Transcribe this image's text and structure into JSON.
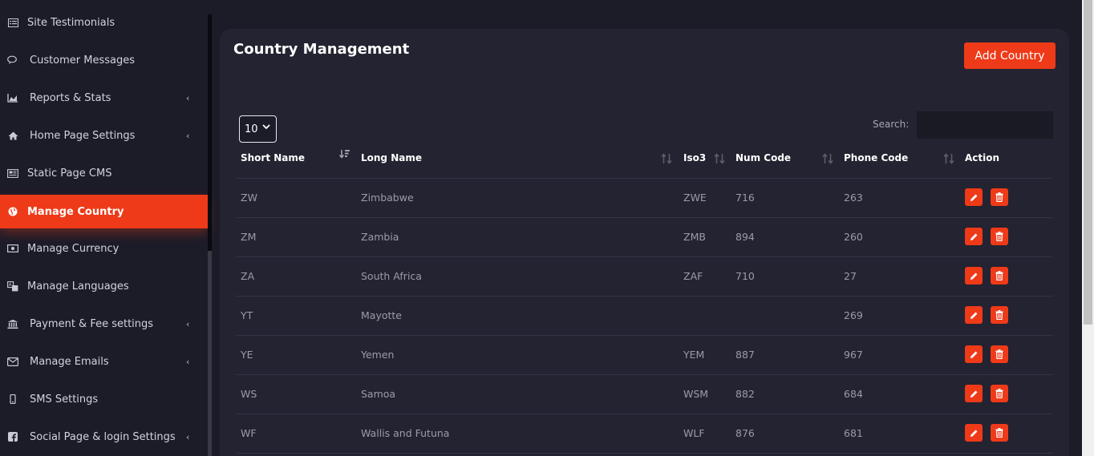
{
  "sidebar": {
    "items": [
      {
        "label": "Site Testimonials",
        "icon": "list-alt-icon",
        "chevron": false,
        "active": false
      },
      {
        "label": "Customer Messages",
        "icon": "comments-icon",
        "chevron": false,
        "active": false
      },
      {
        "label": "Reports & Stats",
        "icon": "area-chart-icon",
        "chevron": true,
        "active": false
      },
      {
        "label": "Home Page Settings",
        "icon": "home-icon",
        "chevron": true,
        "active": false
      },
      {
        "label": "Static Page CMS",
        "icon": "newspaper-icon",
        "chevron": false,
        "active": false
      },
      {
        "label": "Manage Country",
        "icon": "globe-icon",
        "chevron": false,
        "active": true
      },
      {
        "label": "Manage Currency",
        "icon": "money-icon",
        "chevron": false,
        "active": false
      },
      {
        "label": "Manage Languages",
        "icon": "language-icon",
        "chevron": false,
        "active": false
      },
      {
        "label": "Payment & Fee settings",
        "icon": "bank-icon",
        "chevron": true,
        "active": false
      },
      {
        "label": "Manage Emails",
        "icon": "envelope-icon",
        "chevron": true,
        "active": false
      },
      {
        "label": "SMS Settings",
        "icon": "mobile-icon",
        "chevron": false,
        "active": false
      },
      {
        "label": "Social Page & login Settings",
        "icon": "facebook-icon",
        "chevron": true,
        "active": false
      }
    ],
    "chevron_glyph": "‹"
  },
  "main": {
    "title": "Country Management",
    "add_button": "Add Country",
    "page_length": "10",
    "search_label": "Search:",
    "search_value": ""
  },
  "table": {
    "columns": [
      "Short Name",
      "Long Name",
      "Iso3",
      "Num Code",
      "Phone Code",
      "Action"
    ],
    "rows": [
      {
        "short": "ZW",
        "long": "Zimbabwe",
        "iso3": "ZWE",
        "num": "716",
        "phone": "263"
      },
      {
        "short": "ZM",
        "long": "Zambia",
        "iso3": "ZMB",
        "num": "894",
        "phone": "260"
      },
      {
        "short": "ZA",
        "long": "South Africa",
        "iso3": "ZAF",
        "num": "710",
        "phone": "27"
      },
      {
        "short": "YT",
        "long": "Mayotte",
        "iso3": "",
        "num": "",
        "phone": "269"
      },
      {
        "short": "YE",
        "long": "Yemen",
        "iso3": "YEM",
        "num": "887",
        "phone": "967"
      },
      {
        "short": "WS",
        "long": "Samoa",
        "iso3": "WSM",
        "num": "882",
        "phone": "684"
      },
      {
        "short": "WF",
        "long": "Wallis and Futuna",
        "iso3": "WLF",
        "num": "876",
        "phone": "681"
      }
    ]
  },
  "colors": {
    "accent": "#ee3a18",
    "background": "#1c1c28",
    "card": "#232331"
  }
}
